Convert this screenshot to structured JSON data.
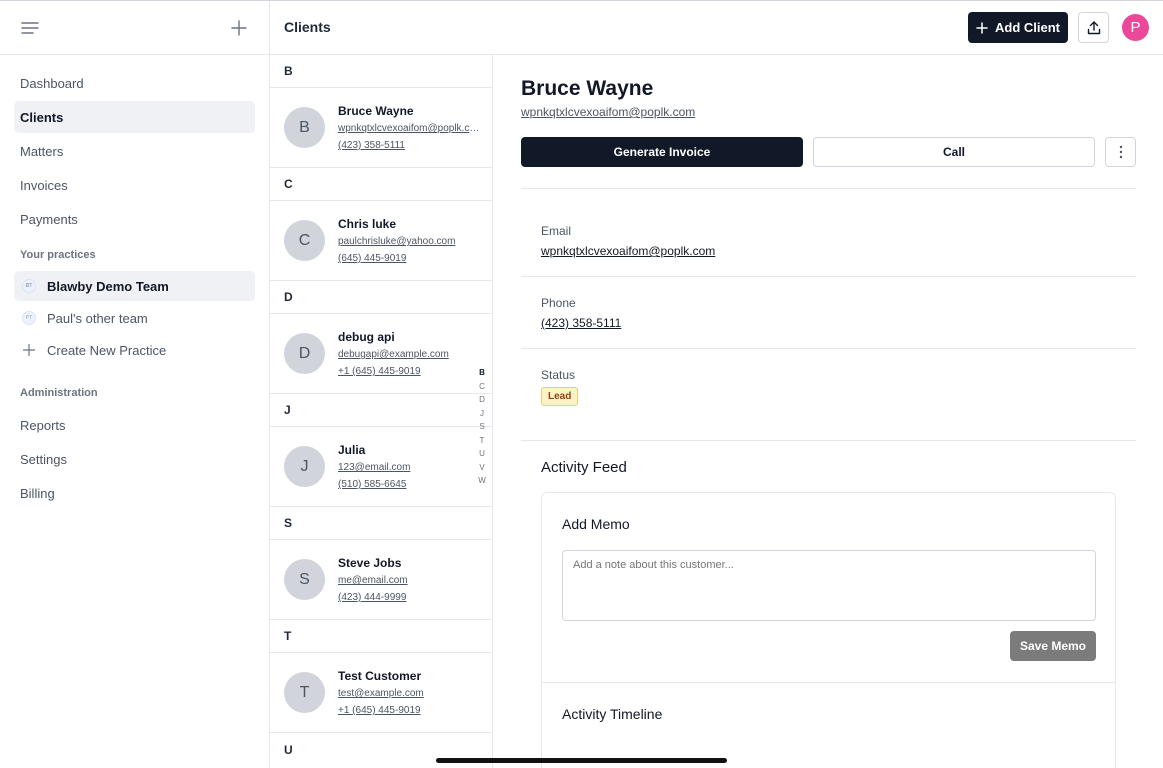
{
  "sidebar": {
    "nav": [
      {
        "label": "Dashboard",
        "active": false
      },
      {
        "label": "Clients",
        "active": true
      },
      {
        "label": "Matters",
        "active": false
      },
      {
        "label": "Invoices",
        "active": false
      },
      {
        "label": "Payments",
        "active": false
      }
    ],
    "practices_label": "Your practices",
    "practices": [
      {
        "badge": "BT",
        "label": "Blawby Demo Team",
        "active": true
      },
      {
        "badge": "PT",
        "label": "Paul's other team",
        "active": false
      }
    ],
    "create_practice_label": "Create New Practice",
    "admin_label": "Administration",
    "admin": [
      {
        "label": "Reports"
      },
      {
        "label": "Settings"
      },
      {
        "label": "Billing"
      }
    ]
  },
  "header": {
    "title": "Clients",
    "add_client_label": "Add Client",
    "avatar_initial": "P"
  },
  "clients": [
    {
      "letter": "B",
      "items": [
        {
          "initial": "B",
          "name": "Bruce Wayne",
          "email": "wpnkqtxlcvexoaifom@poplk.com",
          "phone": "(423) 358-5111"
        }
      ]
    },
    {
      "letter": "C",
      "items": [
        {
          "initial": "C",
          "name": "Chris luke",
          "email": "paulchrisluke@yahoo.com",
          "phone": "(645) 445-9019"
        }
      ]
    },
    {
      "letter": "D",
      "items": [
        {
          "initial": "D",
          "name": "debug api",
          "email": "debugapi@example.com",
          "phone": "+1 (645) 445-9019"
        }
      ]
    },
    {
      "letter": "J",
      "items": [
        {
          "initial": "J",
          "name": "Julia",
          "email": "123@email.com",
          "phone": "(510) 585-6645"
        }
      ]
    },
    {
      "letter": "S",
      "items": [
        {
          "initial": "S",
          "name": "Steve Jobs",
          "email": "me@email.com",
          "phone": "(423) 444-9999"
        }
      ]
    },
    {
      "letter": "T",
      "items": [
        {
          "initial": "T",
          "name": "Test Customer",
          "email": "test@example.com",
          "phone": "+1 (645) 445-9019"
        }
      ]
    },
    {
      "letter": "U",
      "items": []
    }
  ],
  "alpha_index": [
    "B",
    "C",
    "D",
    "J",
    "S",
    "T",
    "U",
    "V",
    "W"
  ],
  "alpha_active": "B",
  "detail": {
    "name": "Bruce Wayne",
    "email": "wpnkqtxlcvexoaifom@poplk.com",
    "generate_invoice_label": "Generate Invoice",
    "call_label": "Call",
    "email_label": "Email",
    "email_value": "wpnkqtxlcvexoaifom@poplk.com",
    "phone_label": "Phone",
    "phone_value": "(423) 358-5111",
    "status_label": "Status",
    "status_value": "Lead",
    "activity_feed_title": "Activity Feed",
    "add_memo_title": "Add Memo",
    "memo_placeholder": "Add a note about this customer...",
    "save_memo_label": "Save Memo",
    "activity_timeline_title": "Activity Timeline"
  },
  "colors": {
    "primary": "#111827",
    "avatar": "#ec4899",
    "status_lead_bg": "#fef3c7",
    "status_lead_text": "#92400e"
  }
}
